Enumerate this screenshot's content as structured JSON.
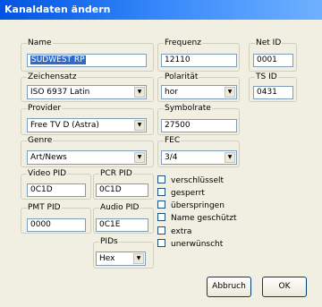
{
  "window": {
    "title": "Kanaldaten ändern"
  },
  "fields": {
    "name": {
      "label": "Name",
      "value": "SÜDWEST RP"
    },
    "frequenz": {
      "label": "Frequenz",
      "value": "12110"
    },
    "net_id": {
      "label": "Net ID",
      "value": "0001"
    },
    "zeichensatz": {
      "label": "Zeichensatz",
      "value": "ISO 6937 Latin"
    },
    "polaritaet": {
      "label": "Polarität",
      "value": "hor"
    },
    "ts_id": {
      "label": "TS ID",
      "value": "0431"
    },
    "provider": {
      "label": "Provider",
      "value": "Free TV D (Astra)"
    },
    "symbolrate": {
      "label": "Symbolrate",
      "value": "27500"
    },
    "genre": {
      "label": "Genre",
      "value": "Art/News"
    },
    "fec": {
      "label": "FEC",
      "value": "3/4"
    },
    "video_pid": {
      "label": "Video PID",
      "value": "0C1D"
    },
    "pcr_pid": {
      "label": "PCR PID",
      "value": "0C1D"
    },
    "pmt_pid": {
      "label": "PMT PID",
      "value": "0000"
    },
    "audio_pid": {
      "label": "Audio PID",
      "value": "0C1E"
    },
    "pids": {
      "label": "PIDs",
      "value": "Hex"
    }
  },
  "checkboxes": [
    {
      "label": "verschlüsselt",
      "checked": false
    },
    {
      "label": "gesperrt",
      "checked": false
    },
    {
      "label": "überspringen",
      "checked": false
    },
    {
      "label": "Name geschützt",
      "checked": false
    },
    {
      "label": "extra",
      "checked": false
    },
    {
      "label": "unerwünscht",
      "checked": false
    }
  ],
  "buttons": {
    "cancel": "Abbruch",
    "ok": "OK"
  },
  "icons": {
    "dropdown": "chevron-down-icon"
  },
  "colors": {
    "titlebar": "#0054e3",
    "dialog_bg": "#f1efe2",
    "selection": "#316ac5"
  }
}
